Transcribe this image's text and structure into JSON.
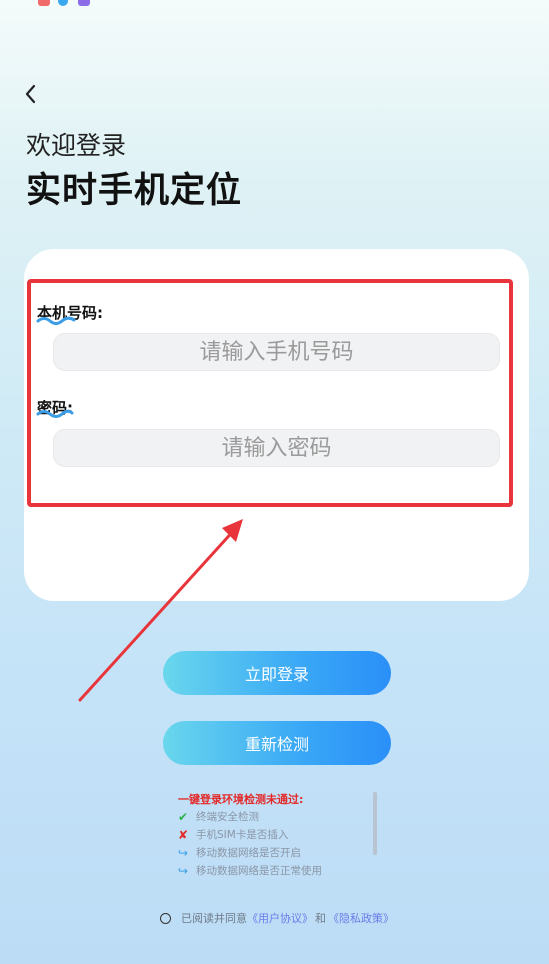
{
  "header": {
    "welcome": "欢迎登录",
    "app_title": "实时手机定位"
  },
  "form": {
    "phone_label": "本机号码:",
    "phone_placeholder": "请输入手机号码",
    "phone_value": "",
    "password_label": "密码:",
    "password_placeholder": "请输入密码",
    "password_value": ""
  },
  "buttons": {
    "login": "立即登录",
    "recheck": "重新检测"
  },
  "env_check": {
    "title": "一键登录环境检测未通过:",
    "items": [
      {
        "icon": "check-icon",
        "symbol": "✔",
        "color": "#2cb34a",
        "label": "终端安全检测"
      },
      {
        "icon": "cross-icon",
        "symbol": "✘",
        "color": "#e32a2a",
        "label": "手机SIM卡是否插入"
      },
      {
        "icon": "arrow-icon",
        "symbol": "↪",
        "color": "#3aa0e8",
        "label": "移动数据网络是否开启"
      },
      {
        "icon": "arrow-icon",
        "symbol": "↪",
        "color": "#3aa0e8",
        "label": "移动数据网络是否正常使用"
      }
    ]
  },
  "agreement": {
    "prefix": "已阅读并同意",
    "user_agreement": "《用户协议》",
    "conjunction": "和",
    "privacy_policy": "《隐私政策》"
  },
  "colors": {
    "highlight": "#e8353b",
    "button_gradient_start": "#69d7ec",
    "button_gradient_end": "#2a8ff8",
    "link": "#6c7be8",
    "warning": "#e32a2a"
  }
}
